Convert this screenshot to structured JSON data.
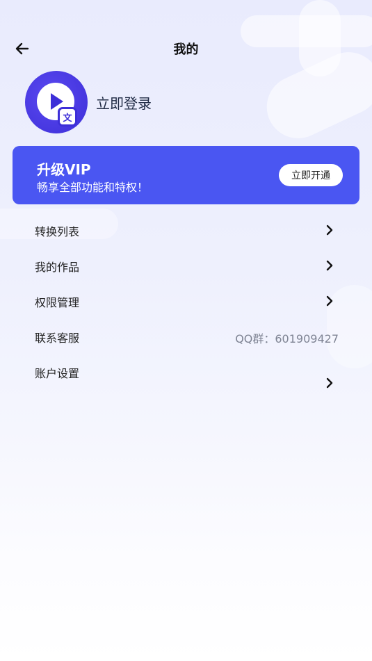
{
  "header": {
    "title": "我的",
    "back_icon": "arrow-left-icon"
  },
  "profile": {
    "login_label": "立即登录",
    "avatar_icon": "play-translate-icon",
    "avatar_badge": "文"
  },
  "vip": {
    "title": "升级VIP",
    "subtitle": "畅享全部功能和特权！",
    "button_label": "立即开通",
    "accent": "#4a56f2"
  },
  "menu": {
    "items": [
      {
        "label": "转换列表",
        "icon": "chevron-right-icon"
      },
      {
        "label": "我的作品",
        "icon": "chevron-right-icon"
      },
      {
        "label": "权限管理",
        "icon": "chevron-right-icon"
      },
      {
        "label": "联系客服",
        "value": "QQ群：601909427"
      },
      {
        "label": "账户设置",
        "icon": "chevron-right-icon"
      }
    ]
  }
}
